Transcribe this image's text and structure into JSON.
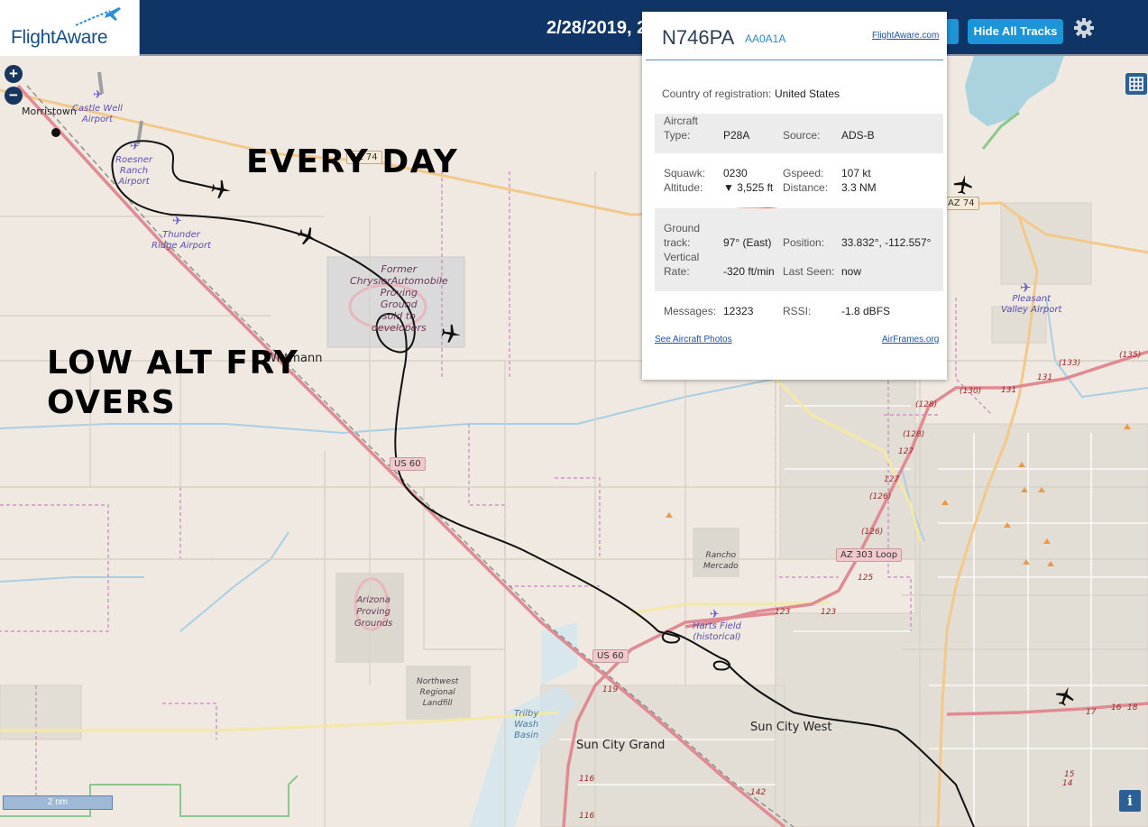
{
  "header": {
    "logo_text": "FlightAware",
    "date_text": "2/28/2019, 2",
    "hide_tracks_label": "Hide All Tracks"
  },
  "annotations": {
    "top": "EVERY DAY",
    "left_line1": "LOW ALT FRY",
    "left_line2": "OVERS"
  },
  "popup": {
    "registration": "N746PA",
    "hex": "AA0A1A",
    "link_site": "FlightAware.com",
    "country_label": "Country of registration:",
    "country_value": "United States",
    "aircraft_type_label_1": "Aircraft",
    "aircraft_type_label_2": "Type:",
    "aircraft_type": "P28A",
    "source_label": "Source:",
    "source": "ADS-B",
    "squawk_label": "Squawk:",
    "squawk": "0230",
    "gspeed_label": "Gspeed:",
    "gspeed": "107 kt",
    "altitude_label": "Altitude:",
    "altitude": "▼ 3,525 ft",
    "distance_label": "Distance:",
    "distance": "3.3 NM",
    "ground_track_label_1": "Ground",
    "ground_track_label_2": "track:",
    "ground_track": "97° (East)",
    "position_label": "Position:",
    "position": "33.832°, -112.557°",
    "vertical_rate_label_1": "Vertical",
    "vertical_rate_label_2": "Rate:",
    "vertical_rate": "-320 ft/min",
    "last_seen_label": "Last Seen:",
    "last_seen": "now",
    "messages_label": "Messages:",
    "messages": "12323",
    "rssi_label": "RSSI:",
    "rssi": "-1.8 dBFS",
    "photos_link": "See Aircraft Photos",
    "airframes_link": "AirFrames.org"
  },
  "map": {
    "zoom_in": "+",
    "zoom_out": "−",
    "scale_label": "2 nm",
    "info_label": "i",
    "labels": {
      "morristown": "Morristown",
      "castle_well_1": "Castle Well",
      "castle_well_2": "Airport",
      "roesner_1": "Roesner",
      "roesner_2": "Ranch",
      "roesner_3": "Airport",
      "thunder_1": "Thunder",
      "thunder_2": "Ridge Airport",
      "chrysler_1": "Former",
      "chrysler_2": "ChryslerAutomobile",
      "chrysler_3": "Proving",
      "chrysler_4": "Ground",
      "chrysler_5": "sold to",
      "chrysler_6": "developers",
      "wittmann": "Wittmann",
      "pleasant_1": "Pleasant",
      "pleasant_2": "Valley Airport",
      "rancho_1": "Rancho",
      "rancho_2": "Mercado",
      "arizona_pg_1": "Arizona",
      "arizona_pg_2": "Proving",
      "arizona_pg_3": "Grounds",
      "harts_1": "Harts Field",
      "harts_2": "(historical)",
      "landfill_1": "Northwest",
      "landfill_2": "Regional",
      "landfill_3": "Landfill",
      "trilby_1": "Trilby",
      "trilby_2": "Wash",
      "trilby_3": "Basin",
      "sun_city_grand": "Sun City Grand",
      "sun_city_west": "Sun City West"
    },
    "shields": {
      "az74_a": "AZ 74",
      "az74_b": "AZ 74",
      "us60_a": "US 60",
      "us60_b": "US 60",
      "az303": "AZ 303 Loop"
    },
    "markers": {
      "m135": "(135)",
      "m133": "(133)",
      "m131": "131",
      "m131b": "131",
      "m130": "(130)",
      "m128a": "(128)",
      "m128b": "(128)",
      "m127a": "127",
      "m127b": "127",
      "m126a": "(126)",
      "m126b": "(126)",
      "m125": "125",
      "m123a": "123",
      "m123b": "123",
      "m119": "119",
      "m116a": "116",
      "m116b": "116",
      "m142": "142",
      "m17": "17",
      "m16": "16",
      "m18": "18",
      "m15": "15",
      "m14": "14"
    }
  }
}
